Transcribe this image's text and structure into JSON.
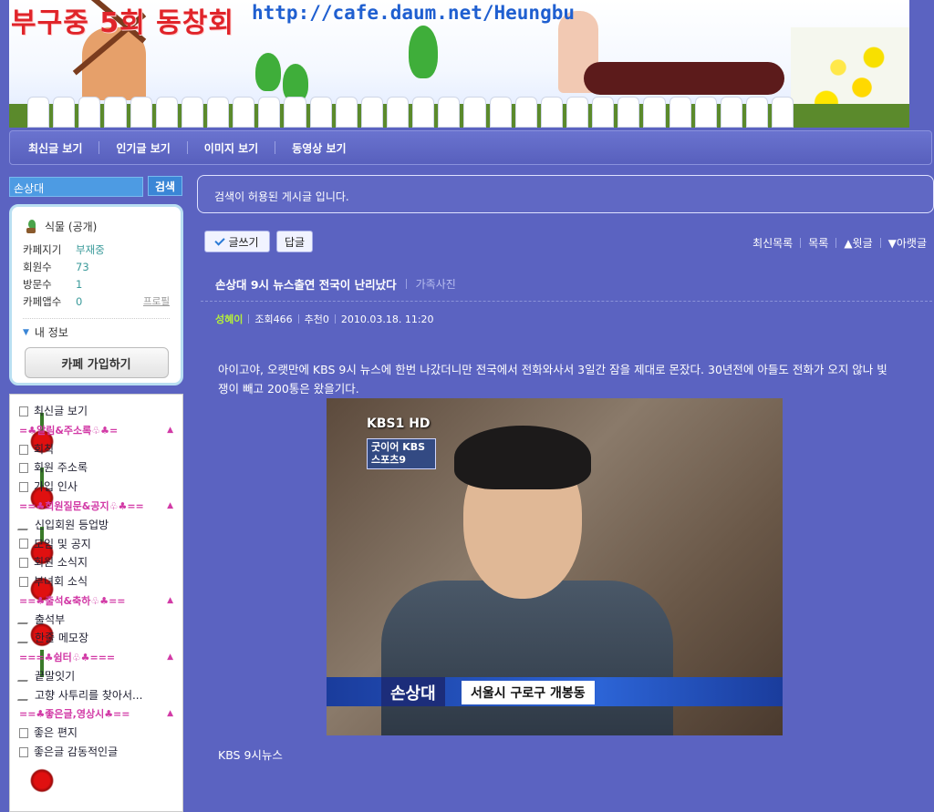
{
  "banner": {
    "title": "부구중 5회 동창회",
    "url": "http://cafe.daum.net/Heungbu"
  },
  "nav": {
    "items": [
      "최신글 보기",
      "인기글 보기",
      "이미지 보기",
      "동영상 보기"
    ]
  },
  "sidebar": {
    "search_value": "손상대",
    "search_button": "검색",
    "cafe_level": "식물 (공개)",
    "stats": [
      {
        "label": "카페지기",
        "value": "부재중"
      },
      {
        "label": "회원수",
        "value": "73"
      },
      {
        "label": "방문수",
        "value": "1"
      },
      {
        "label": "카페앱수",
        "value": "0"
      }
    ],
    "profile_link": "프로필",
    "my_info": "내 정보",
    "join_button": "카페 가입하기",
    "menu": [
      {
        "type": "item",
        "icon": "new-icon",
        "label": "최신글 보기"
      },
      {
        "type": "header",
        "label": "=♣알림&주소록♧♣="
      },
      {
        "type": "item",
        "icon": "board-icon",
        "label": "회칙"
      },
      {
        "type": "item",
        "icon": "board-icon",
        "label": "회원 주소록"
      },
      {
        "type": "item",
        "icon": "board-icon",
        "label": "가입 인사"
      },
      {
        "type": "header",
        "label": "==♣회원질문&공지♧♣=="
      },
      {
        "type": "item",
        "icon": "pen-icon",
        "label": "신입회원 등업방"
      },
      {
        "type": "item",
        "icon": "board-icon",
        "label": "모임 및 공지"
      },
      {
        "type": "item",
        "icon": "board-icon",
        "label": "회원 소식지"
      },
      {
        "type": "item",
        "icon": "board-icon",
        "label": "부녀회 소식"
      },
      {
        "type": "header",
        "label": "==♣출석&축하♧♣=="
      },
      {
        "type": "item",
        "icon": "pen-icon",
        "label": "출석부"
      },
      {
        "type": "item",
        "icon": "pen-icon",
        "label": "한줄 메모장"
      },
      {
        "type": "header",
        "label": "===♣쉼터♧♣==="
      },
      {
        "type": "item",
        "icon": "pen-icon",
        "label": "끝말잇기"
      },
      {
        "type": "item",
        "icon": "pen-icon",
        "label": "고향 사투리를 찾아서..."
      },
      {
        "type": "header",
        "label": "==♣좋은글,영상시♣=="
      },
      {
        "type": "item",
        "icon": "board-icon",
        "label": "좋은 편지"
      },
      {
        "type": "item",
        "icon": "board-icon",
        "label": "좋은글 감동적인글"
      }
    ]
  },
  "main": {
    "notice": "검색이 허용된 게시글 입니다.",
    "write_button": "글쓰기",
    "reply_button": "답글",
    "right_actions": [
      "최신목록",
      "목록",
      "▲윗글",
      "▼아랫글"
    ],
    "post_title": "손상대 9시 뉴스출연 전국이 난리났다",
    "post_category": "가족사진",
    "author": "성혜이",
    "views": "조회466",
    "recommend": "추천0",
    "date": "2010.03.18. 11:20",
    "body": "아이고야, 오랫만에 KBS 9시 뉴스에 한번 나갔더니만 전국에서 전화와사서 3일간 잠을 제대로 몬잤다. 30년전에 아들도 전화가 오지 않나 빛쟁이 빼고 200통은 왔을기다.",
    "photo_logo": "KBS1 HD",
    "photo_logo2": "굿이어 KBS스포츠9",
    "photo_name": "손상대",
    "photo_location": "서울시 구로구 개봉동",
    "caption": "KBS 9시뉴스"
  }
}
